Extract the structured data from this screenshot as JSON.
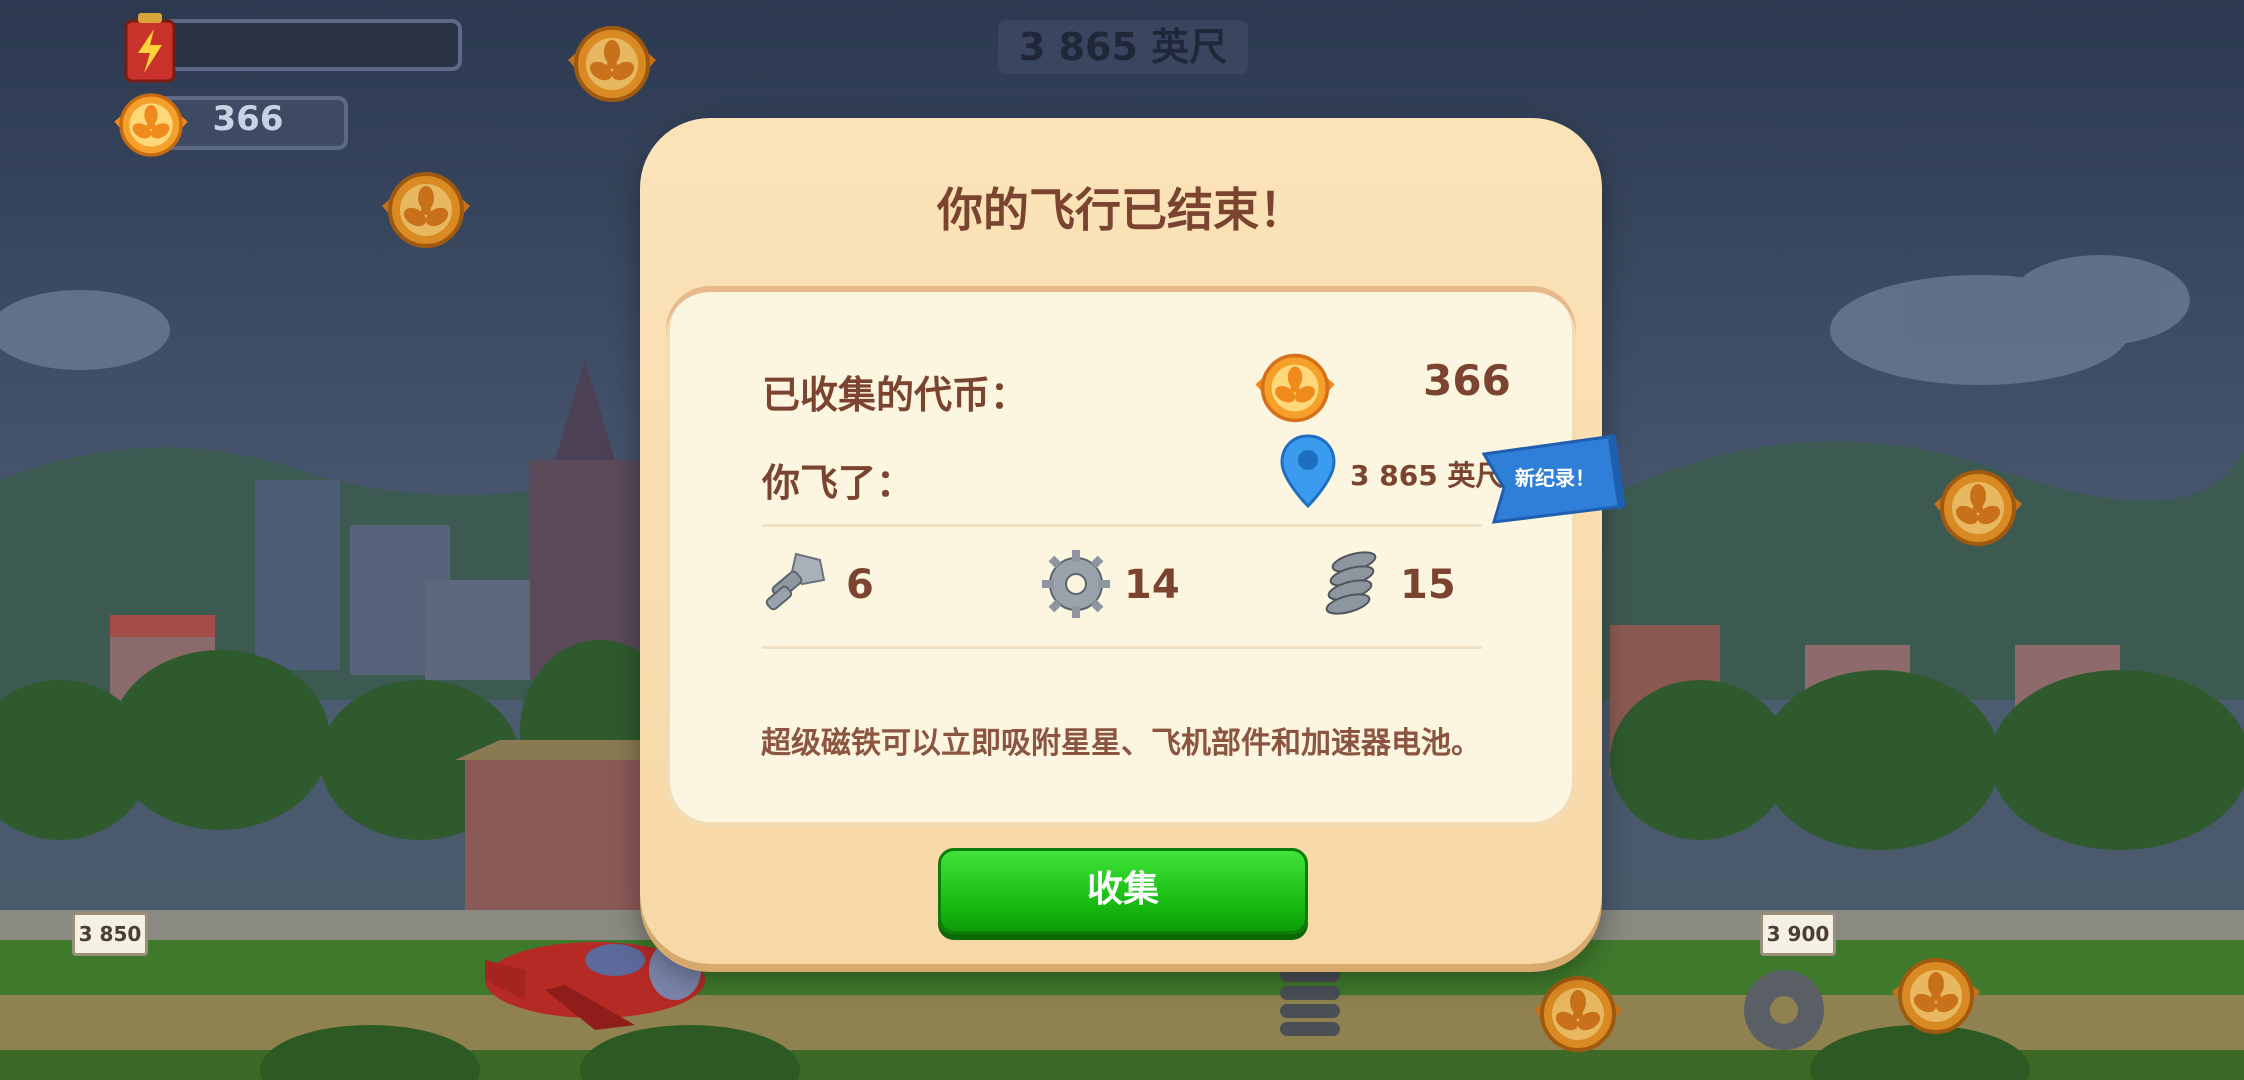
{
  "hud": {
    "coin_count": "366",
    "distance": "3 865 英尺"
  },
  "dialog": {
    "title": "你的飞行已结束！",
    "coins_label": "已收集的代币：",
    "coins_value": "366",
    "flown_label": "你飞了：",
    "flown_value": "3 865 英尺",
    "record_badge": "新纪录！",
    "parts": [
      {
        "icon": "bolt-icon",
        "value": "6"
      },
      {
        "icon": "gear-icon",
        "value": "14"
      },
      {
        "icon": "spring-icon",
        "value": "15"
      }
    ],
    "hint": "超级磁铁可以立即吸附星星、飞机部件和加速器电池。",
    "collect_label": "收集"
  },
  "signs": {
    "left": "3 850",
    "right": "3 900"
  },
  "colors": {
    "dialog_bg": "#fbe3b9",
    "title_text": "#7a4430",
    "collect_button": "#16b80f",
    "ribbon": "#2f7fd8",
    "coin": "#f08a1c"
  }
}
